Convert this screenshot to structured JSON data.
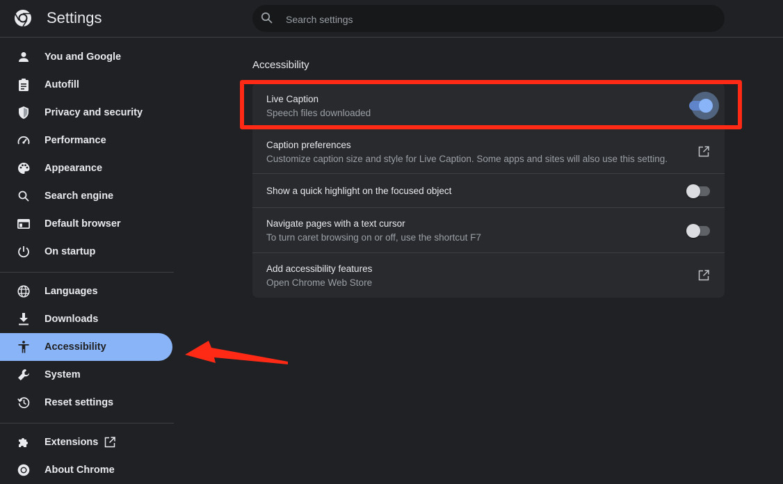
{
  "app": {
    "title": "Settings"
  },
  "search": {
    "placeholder": "Search settings"
  },
  "sidebar": {
    "items": [
      {
        "label": "You and Google",
        "icon": "person-icon"
      },
      {
        "label": "Autofill",
        "icon": "clipboard-icon"
      },
      {
        "label": "Privacy and security",
        "icon": "shield-icon"
      },
      {
        "label": "Performance",
        "icon": "speedometer-icon"
      },
      {
        "label": "Appearance",
        "icon": "palette-icon"
      },
      {
        "label": "Search engine",
        "icon": "search-icon"
      },
      {
        "label": "Default browser",
        "icon": "browser-window-icon"
      },
      {
        "label": "On startup",
        "icon": "power-icon"
      },
      {
        "label": "Languages",
        "icon": "globe-icon"
      },
      {
        "label": "Downloads",
        "icon": "download-icon"
      },
      {
        "label": "Accessibility",
        "icon": "accessibility-icon",
        "active": true
      },
      {
        "label": "System",
        "icon": "wrench-icon"
      },
      {
        "label": "Reset settings",
        "icon": "history-icon"
      },
      {
        "label": "Extensions",
        "icon": "puzzle-icon"
      },
      {
        "label": "About Chrome",
        "icon": "chrome-icon"
      }
    ]
  },
  "main": {
    "section_title": "Accessibility",
    "rows": [
      {
        "title": "Live Caption",
        "subtitle": "Speech files downloaded",
        "control": "toggle",
        "on": true
      },
      {
        "title": "Caption preferences",
        "subtitle": "Customize caption size and style for Live Caption. Some apps and sites will also use this setting.",
        "control": "external-link"
      },
      {
        "title": "Show a quick highlight on the focused object",
        "control": "toggle",
        "on": false
      },
      {
        "title": "Navigate pages with a text cursor",
        "subtitle": "To turn caret browsing on or off, use the shortcut F7",
        "control": "toggle",
        "on": false
      },
      {
        "title": "Add accessibility features",
        "subtitle": "Open Chrome Web Store",
        "control": "external-link"
      }
    ]
  },
  "colors": {
    "background": "#202124",
    "accent": "#8ab4f8",
    "annotation": "#ff2a16"
  }
}
